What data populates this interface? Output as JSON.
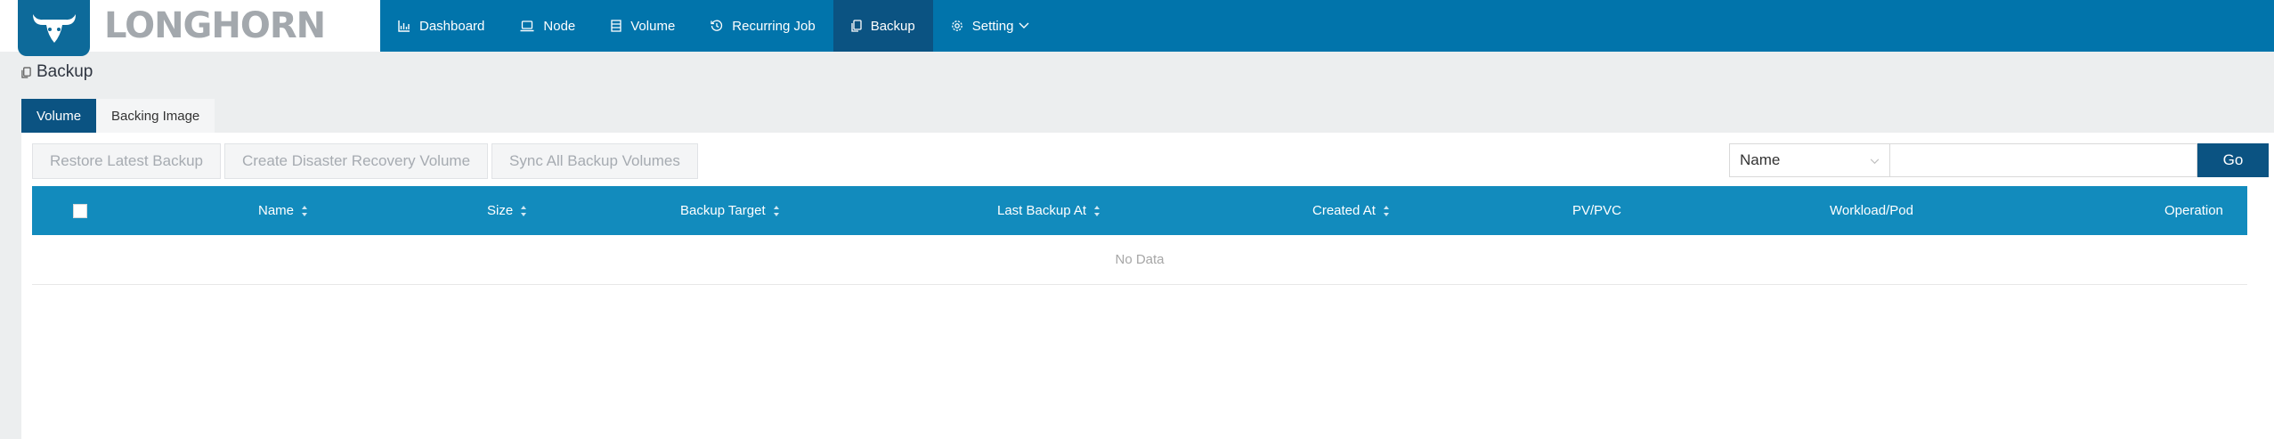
{
  "app": {
    "logo_text": "LONGHORN",
    "logo_icon": "longhorn-bull-icon"
  },
  "nav": {
    "items": [
      {
        "label": "Dashboard",
        "icon": "area-chart-icon"
      },
      {
        "label": "Node",
        "icon": "laptop-icon"
      },
      {
        "label": "Volume",
        "icon": "database-icon"
      },
      {
        "label": "Recurring Job",
        "icon": "history-icon"
      },
      {
        "label": "Backup",
        "icon": "copy-icon",
        "active": true
      },
      {
        "label": "Setting",
        "icon": "gear-icon",
        "dropdown": true
      }
    ]
  },
  "page": {
    "title": "Backup",
    "title_icon": "copy-icon"
  },
  "tabs": [
    {
      "label": "Volume",
      "active": true
    },
    {
      "label": "Backing Image",
      "active": false
    }
  ],
  "toolbar": {
    "restore_latest_label": "Restore Latest Backup",
    "create_dr_label": "Create Disaster Recovery Volume",
    "sync_all_label": "Sync All Backup Volumes"
  },
  "search": {
    "field_selected": "Name",
    "input_value": "",
    "go_label": "Go"
  },
  "table": {
    "columns": [
      "Name",
      "Size",
      "Backup Target",
      "Last Backup At",
      "Created At",
      "PV/PVC",
      "Workload/Pod",
      "Operation"
    ],
    "empty_text": "No Data"
  },
  "colors": {
    "header_bg": "#0174ab",
    "active_bg": "#0b5382",
    "table_header_bg": "#128bbd",
    "logo_badge": "#0d6a9a",
    "logo_text": "#a3a8ad"
  }
}
